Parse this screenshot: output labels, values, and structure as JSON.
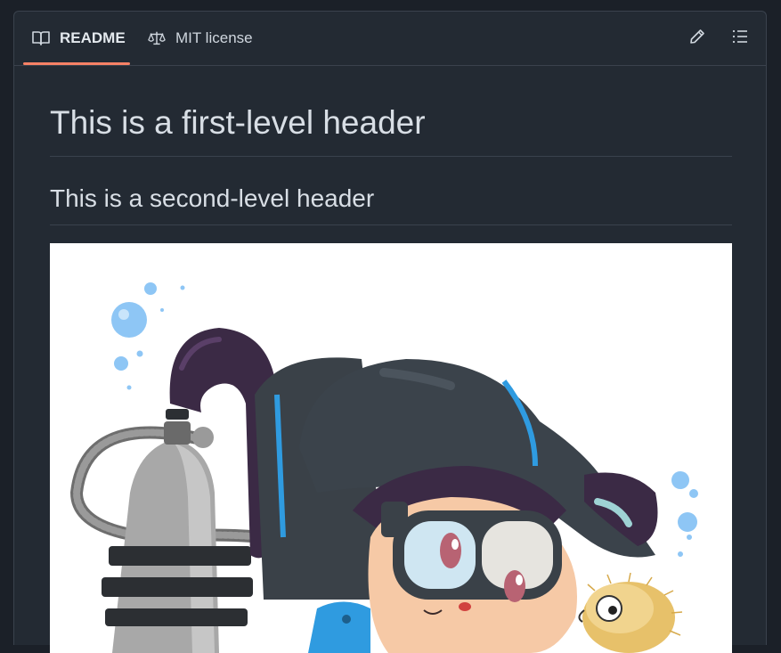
{
  "tabs": [
    {
      "label": "README",
      "icon": "book-icon",
      "active": true
    },
    {
      "label": "MIT license",
      "icon": "law-scale-icon",
      "active": false
    }
  ],
  "toolbar": {
    "edit_icon": "pencil-icon",
    "outline_icon": "list-icon"
  },
  "readme": {
    "h1": "This is a first-level header",
    "h2": "This is a second-level header",
    "image": "octocat-scuba-diver-illustration"
  },
  "colors": {
    "accent_underline": "#f78166",
    "background": "#232a33",
    "border": "#3a424d",
    "heading_text": "#d8dee5"
  }
}
